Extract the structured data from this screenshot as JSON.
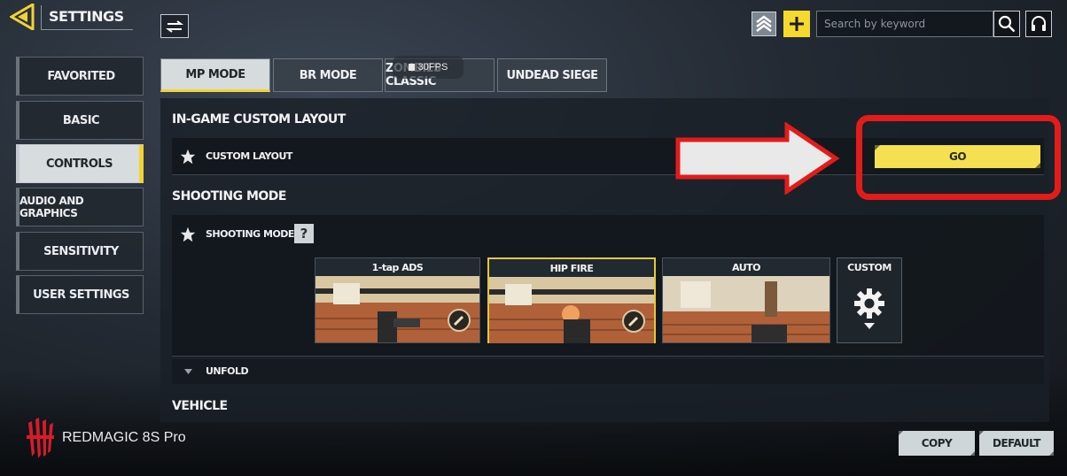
{
  "header": {
    "title": "SETTINGS",
    "search_placeholder": "Search by keyword"
  },
  "sidebar": {
    "items": [
      {
        "label": "FAVORITED",
        "active": false
      },
      {
        "label": "BASIC",
        "active": false
      },
      {
        "label": "CONTROLS",
        "active": true
      },
      {
        "label": "AUDIO AND GRAPHICS",
        "active": false
      },
      {
        "label": "SENSITIVITY",
        "active": false
      },
      {
        "label": "USER SETTINGS",
        "active": false
      }
    ]
  },
  "tabs": [
    {
      "label": "MP MODE",
      "active": true
    },
    {
      "label": "BR MODE",
      "active": false
    },
    {
      "label": "ZOMBIES CLASSIC",
      "active": false
    },
    {
      "label": "UNDEAD SIEGE",
      "active": false
    }
  ],
  "fps_badge": "30FPS",
  "sections": {
    "custom_layout": {
      "heading": "IN-GAME CUSTOM LAYOUT",
      "row_label": "CUSTOM LAYOUT",
      "button_label": "GO"
    },
    "shooting_mode": {
      "heading": "SHOOTING MODE",
      "row_label": "SHOOTING MODE",
      "help": "?",
      "options": [
        {
          "label": "1-tap ADS",
          "selected": false
        },
        {
          "label": "HIP FIRE",
          "selected": true
        },
        {
          "label": "AUTO",
          "selected": false
        },
        {
          "label": "CUSTOM",
          "selected": false
        }
      ],
      "unfold_label": "UNFOLD"
    },
    "vehicle": {
      "heading": "VEHICLE"
    }
  },
  "footer": {
    "brand": "REDMAGIC 8S Pro",
    "copy_label": "COPY",
    "default_label": "DEFAULT"
  },
  "colors": {
    "accent": "#f3d233",
    "go_button": "#f5e051",
    "highlight": "#e21b1b"
  },
  "icons": [
    "back-icon",
    "swap-icon",
    "rank-icon",
    "plus-icon",
    "search-icon",
    "headset-icon",
    "star-icon",
    "gear-icon",
    "knife-icon",
    "caret-down-icon",
    "redmagic-logo-icon"
  ]
}
